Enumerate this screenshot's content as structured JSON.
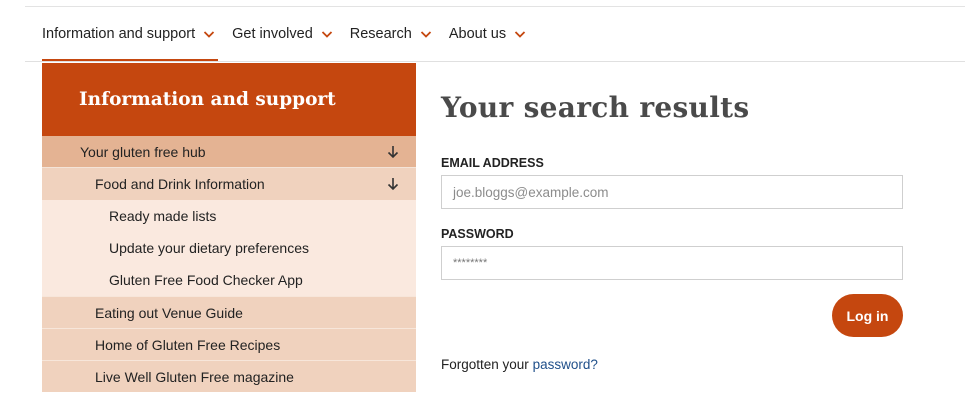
{
  "nav": {
    "items": [
      {
        "label": "Information and support",
        "active": true
      },
      {
        "label": "Get involved"
      },
      {
        "label": "Research"
      },
      {
        "label": "About us"
      }
    ]
  },
  "sidebar": {
    "heading": "Information and support",
    "items": [
      {
        "label": "Your gluten free hub",
        "level": 1,
        "expanded": true
      },
      {
        "label": "Food and Drink Information",
        "level": 2,
        "expanded": true
      },
      {
        "label": "Ready made lists",
        "level": 3
      },
      {
        "label": "Update your dietary preferences",
        "level": 3
      },
      {
        "label": "Gluten Free Food Checker App",
        "level": 3
      },
      {
        "label": "Eating out Venue Guide",
        "level": 2
      },
      {
        "label": "Home of Gluten Free Recipes",
        "level": 2
      },
      {
        "label": "Live Well Gluten Free magazine",
        "level": 2
      }
    ]
  },
  "main": {
    "title": "Your search results",
    "email_label": "EMAIL ADDRESS",
    "email_placeholder": "joe.bloggs@example.com",
    "password_label": "PASSWORD",
    "password_value": "********",
    "login_label": "Log in",
    "forgot_text": "Forgotten your",
    "forgot_link": "password?"
  },
  "colors": {
    "accent": "#c5470f",
    "sidebar_level1": "#e4b393",
    "sidebar_level2": "#f0d2be",
    "sidebar_level3": "#fae9df",
    "link": "#1f4f8a"
  },
  "icons": {
    "nav_chevron": "chevron-down-icon",
    "expand_arrow": "arrow-down-icon"
  }
}
